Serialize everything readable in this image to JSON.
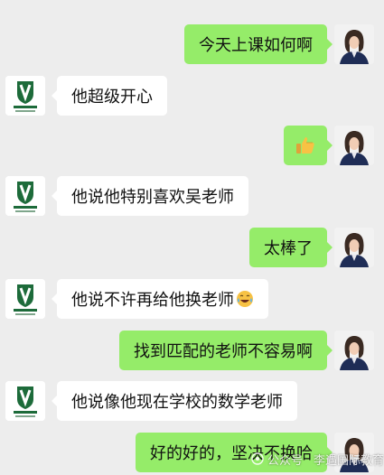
{
  "messages": [
    {
      "side": "right",
      "text": "今天上课如何啊"
    },
    {
      "side": "left",
      "text": "他超级开心"
    },
    {
      "side": "right",
      "emoji": "thumbs-up",
      "glyph": "👍"
    },
    {
      "side": "left",
      "text": "他说他特别喜欢吴老师"
    },
    {
      "side": "right",
      "text": "太棒了"
    },
    {
      "side": "left",
      "text": "他说不许再给他换老师",
      "emoji": "tears-of-joy",
      "glyph": "😂"
    },
    {
      "side": "right",
      "text": "找到匹配的老师不容易啊"
    },
    {
      "side": "left",
      "text": "他说像他现在学校的数学老师"
    },
    {
      "side": "right",
      "text": "好的好的，坚决不换哈"
    }
  ],
  "watermark": {
    "prefix": "公众号",
    "name": "李遇国际教育"
  },
  "colors": {
    "background": "#ededed",
    "outgoing": "#95ec69",
    "incoming": "#ffffff",
    "school_brand": "#1d6b3a"
  }
}
